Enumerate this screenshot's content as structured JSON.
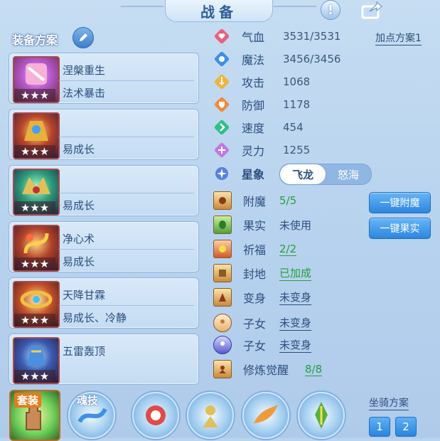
{
  "title": "战备",
  "equipment": {
    "label": "装备方案",
    "items": [
      {
        "name": "涅槃重生",
        "skill": "法术暴击",
        "stars": "★★★"
      },
      {
        "name": "",
        "skill": "易成长",
        "stars": "★★★"
      },
      {
        "name": "",
        "skill": "易成长",
        "stars": "★★★"
      },
      {
        "name": "净心术",
        "skill": "易成长",
        "stars": "★★★"
      },
      {
        "name": "天降甘霖",
        "skill": "易成长、冷静",
        "stars": "★★★"
      },
      {
        "name": "五雷轰顶",
        "skill": "",
        "stars": "★★★"
      }
    ]
  },
  "stats": {
    "plan_link": "加点方案1",
    "rows": [
      {
        "label": "气血",
        "value": "3531/3531",
        "icon": "heart-icon",
        "color": "#e8607a"
      },
      {
        "label": "魔法",
        "value": "3456/3456",
        "icon": "mana-icon",
        "color": "#3f8fe6"
      },
      {
        "label": "攻击",
        "value": "1068",
        "icon": "sword-icon",
        "color": "#f0b43a"
      },
      {
        "label": "防御",
        "value": "1178",
        "icon": "shield-icon",
        "color": "#f08a3a"
      },
      {
        "label": "速度",
        "value": "454",
        "icon": "speed-icon",
        "color": "#2fc08a"
      },
      {
        "label": "灵力",
        "value": "1255",
        "icon": "spirit-icon",
        "color": "#c07ae0"
      }
    ],
    "constellation_label": "星象",
    "constellation_options": [
      "飞龙",
      "怒海"
    ]
  },
  "extras": [
    {
      "label": "附魔",
      "value": "5/5",
      "style": "green"
    },
    {
      "label": "果实",
      "value": "未使用",
      "style": "plain"
    },
    {
      "label": "祈福",
      "value": "2/2",
      "style": "green-ul"
    },
    {
      "label": "封地",
      "value": "已加成",
      "style": "green-ul"
    },
    {
      "label": "变身",
      "value": "未变身",
      "style": "blue"
    },
    {
      "label": "子女",
      "value": "未变身",
      "style": "blue"
    },
    {
      "label": "子女",
      "value": "未变身",
      "style": "blue"
    },
    {
      "label": "修炼觉醒",
      "value": "8/8",
      "style": "green-ul"
    }
  ],
  "buttons": {
    "enchant_all": "一键附魔",
    "fruit_all": "一键果实"
  },
  "bottom": {
    "suit_label": "套装",
    "soul_label": "魂技",
    "mount_plan": "坐骑方案",
    "mount_buttons": [
      "1",
      "2"
    ]
  }
}
